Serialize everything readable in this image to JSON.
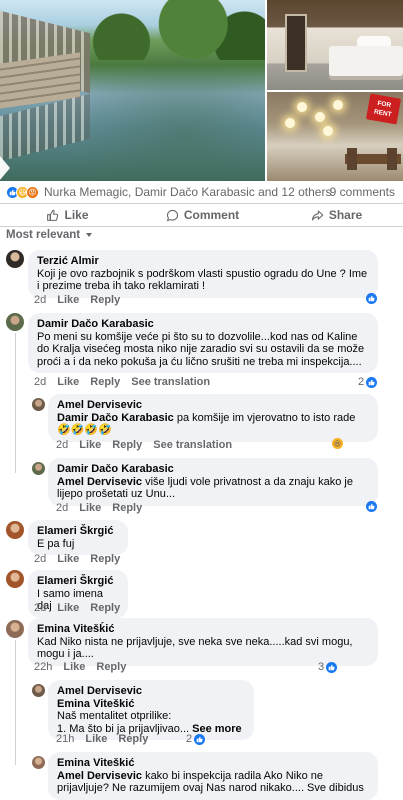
{
  "post": {
    "reactions_text": "Nurka Memagic, Damir Dačo Karabasic and 12 others",
    "comments_count": "9 comments",
    "photo_badge": "FOR RENT"
  },
  "actions": {
    "like": "Like",
    "comment": "Comment",
    "share": "Share"
  },
  "sort_label": "Most relevant",
  "labels": {
    "like": "Like",
    "reply": "Reply",
    "see_translation": "See translation",
    "see_more": "See more"
  },
  "comments": [
    {
      "author": "Terzić Almir",
      "text": "Koji je ovo razbojnik s podrškom vlasti spustio ogradu do Une ? Ime i prezime treba ih tako reklamirati !",
      "time": "2d"
    },
    {
      "author": "Damir Dačo Karabasic",
      "text": "Po meni su komšije veće pi što su to dozvolile...kod nas od Kaline do Kralja visećeg mosta niko nije zaradio svi su ostavili da se može proći a i da neko pokuša ja ću lično srušiti ne treba mi inspekcija....",
      "time": "2d",
      "reaction_count": "2"
    },
    {
      "author": "Amel Dervisevic",
      "mention": "Damir Dačo Karabasic",
      "text": "pa komšije im vjerovatno to isto rade 🤣🤣🤣🤣",
      "time": "2d"
    },
    {
      "author": "Damir Dačo Karabasic",
      "mention": "Amel Dervisevic",
      "text": "više ljudi vole privatnost a da znaju kako je lijepo prošetati uz Unu...",
      "time": "2d"
    },
    {
      "author": "Elameri Škrgić",
      "text": "E pa fuj",
      "time": "2d"
    },
    {
      "author": "Elameri Škrgić",
      "text": "I samo imena daj",
      "time": "2d"
    },
    {
      "author": "Emina Vitešḱić",
      "text": "Kad Niko nista ne prijavljuje, sve neka sve neka.....kad svi mogu, mogu i ja....",
      "time": "22h",
      "reaction_count": "3"
    },
    {
      "author": "Amel Dervisevic",
      "mention": "Emina Viteškić",
      "text": "Naš mentalitet otprilike:",
      "text2": "1. Ma što bi ja prijavljivao...",
      "time": "21h",
      "reaction_count": "2"
    },
    {
      "author": "Emina Viteškić",
      "mention": "Amel Dervisevic",
      "text": "kako bi inspekcija radila Ako Niko ne prijavljuje? Ne razumijem ovaj Nas narod nikako.... Sve dibidus"
    }
  ],
  "colors": {
    "accent": "#1877f2",
    "bubble": "#f0f2f5",
    "muted": "#65676b"
  }
}
